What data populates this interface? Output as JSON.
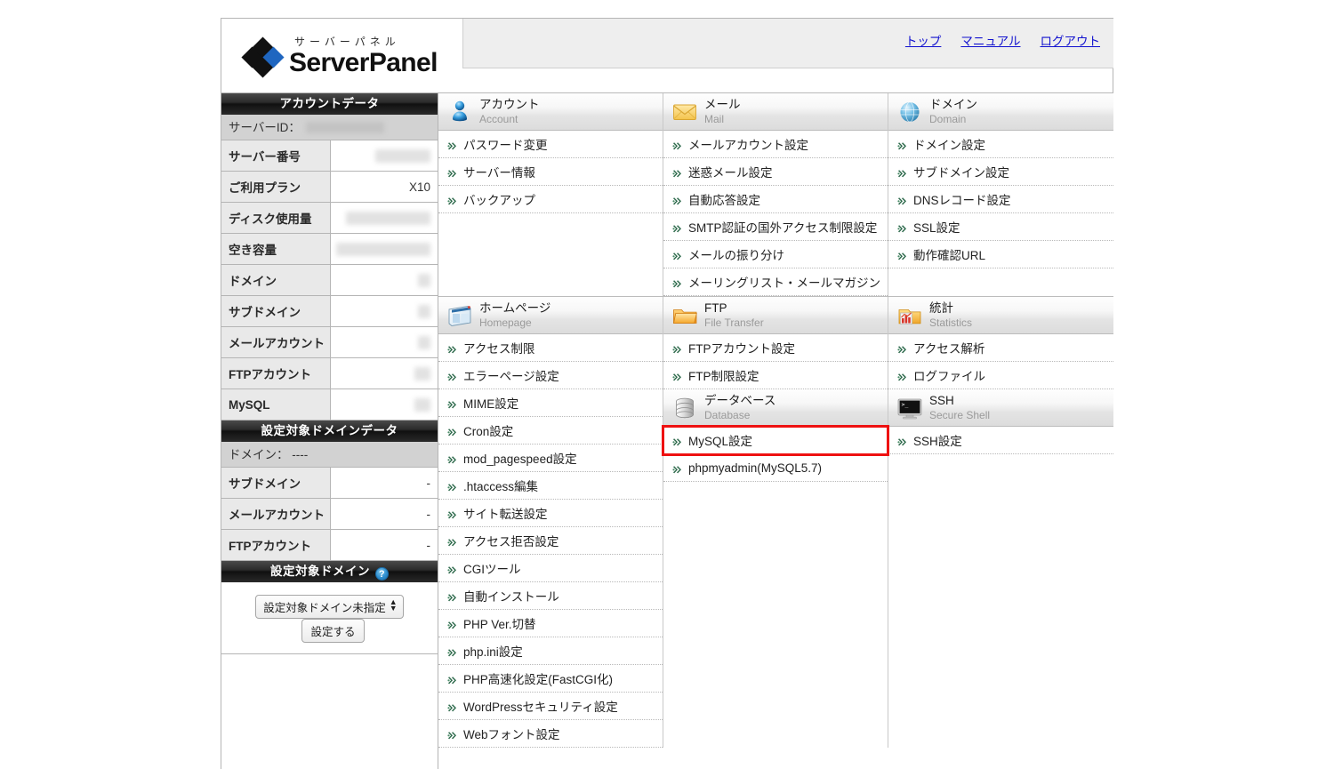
{
  "header": {
    "logo_kana": "サーバーパネル",
    "logo_name": "ServerPanel",
    "links": [
      {
        "label": "トップ",
        "name": "top-link"
      },
      {
        "label": "マニュアル",
        "name": "manual-link"
      },
      {
        "label": "ログアウト",
        "name": "logout-link"
      }
    ]
  },
  "sidebar": {
    "account_data_title": "アカウントデータ",
    "server_id_label": "サーバーID：",
    "server_id_value": "",
    "rows": [
      {
        "key": "サーバー番号",
        "value": "",
        "redacted": true,
        "redact_w": 62
      },
      {
        "key": "ご利用プラン",
        "value": "X10",
        "redacted": false,
        "redact_w": 0
      },
      {
        "key": "ディスク使用量",
        "value": "",
        "redacted": true,
        "redact_w": 95
      },
      {
        "key": "空き容量",
        "value": "",
        "redacted": true,
        "redact_w": 112
      },
      {
        "key": "ドメイン",
        "value": "",
        "redacted": true,
        "redact_w": 14
      },
      {
        "key": "サブドメイン",
        "value": "",
        "redacted": true,
        "redact_w": 14
      },
      {
        "key": "メールアカウント",
        "value": "",
        "redacted": true,
        "redact_w": 14
      },
      {
        "key": "FTPアカウント",
        "value": "",
        "redacted": true,
        "redact_w": 18
      },
      {
        "key": "MySQL",
        "value": "",
        "redacted": true,
        "redact_w": 18
      }
    ],
    "target_domain_data_title": "設定対象ドメインデータ",
    "target_domain_label": "ドメイン：  ----",
    "target_rows": [
      {
        "key": "サブドメイン",
        "value": "-"
      },
      {
        "key": "メールアカウント",
        "value": "-"
      },
      {
        "key": "FTPアカウント",
        "value": "-"
      }
    ],
    "target_domain_title": "設定対象ドメイン",
    "help_badge": "?",
    "domain_select_value": "設定対象ドメイン未指定",
    "set_button_label": "設定する"
  },
  "main": {
    "block1": [
      {
        "icon": "person-icon",
        "title_jp": "アカウント",
        "title_en": "Account",
        "items": [
          "パスワード変更",
          "サーバー情報",
          "バックアップ"
        ]
      },
      {
        "icon": "envelope-icon",
        "title_jp": "メール",
        "title_en": "Mail",
        "items": [
          "メールアカウント設定",
          "迷惑メール設定",
          "自動応答設定",
          "SMTP認証の国外アクセス制限設定",
          "メールの振り分け",
          "メーリングリスト・メールマガジン"
        ]
      },
      {
        "icon": "globe-icon",
        "title_jp": "ドメイン",
        "title_en": "Domain",
        "items": [
          "ドメイン設定",
          "サブドメイン設定",
          "DNSレコード設定",
          "SSL設定",
          "動作確認URL"
        ]
      }
    ],
    "block2": [
      {
        "icon": "homepage-icon",
        "title_jp": "ホームページ",
        "title_en": "Homepage",
        "items": [
          "アクセス制限",
          "エラーページ設定",
          "MIME設定",
          "Cron設定",
          "mod_pagespeed設定",
          ".htaccess編集",
          "サイト転送設定",
          "アクセス拒否設定",
          "CGIツール",
          "自動インストール",
          "PHP Ver.切替",
          "php.ini設定",
          "PHP高速化設定(FastCGI化)",
          "WordPressセキュリティ設定",
          "Webフォント設定"
        ]
      },
      {
        "icon": "folder-icon",
        "title_jp": "FTP",
        "title_en": "File Transfer",
        "items": [
          "FTPアカウント設定",
          "FTP制限設定"
        ]
      },
      {
        "icon": "chart-icon",
        "title_jp": "統計",
        "title_en": "Statistics",
        "items": [
          "アクセス解析",
          "ログファイル"
        ]
      }
    ],
    "block3": [
      {
        "icon": "database-icon",
        "title_jp": "データベース",
        "title_en": "Database",
        "items": [
          {
            "label": "MySQL設定",
            "highlighted": true
          },
          {
            "label": "phpmyadmin(MySQL5.7)",
            "highlighted": false
          }
        ]
      },
      {
        "icon": "terminal-icon",
        "title_jp": "SSH",
        "title_en": "Secure Shell",
        "items": [
          {
            "label": "SSH設定",
            "highlighted": false
          }
        ]
      }
    ]
  },
  "colors": {
    "highlight": "#ee1111",
    "link": "#1212cf",
    "title_bar": "#101010",
    "accent_blue": "#1f66c0"
  }
}
